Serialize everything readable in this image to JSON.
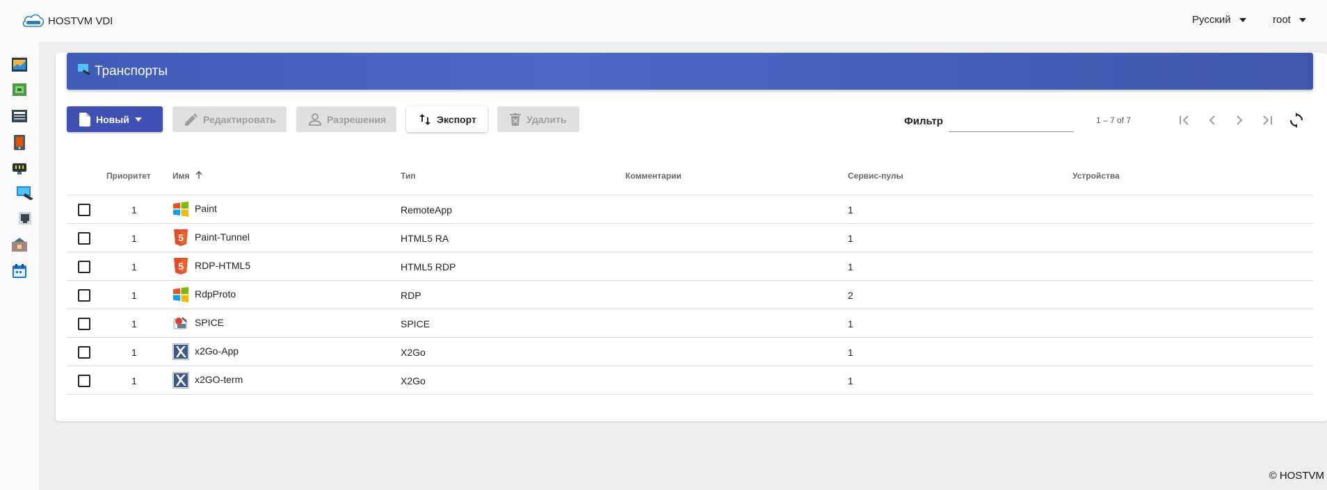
{
  "app": {
    "title": "HOSTVM VDI"
  },
  "topbar": {
    "language": "Русский",
    "user": "root"
  },
  "sidebar": {
    "items": [
      {
        "icon": "dashboard-icon"
      },
      {
        "icon": "services-chip-icon"
      },
      {
        "icon": "authenticators-icon"
      },
      {
        "icon": "os-managers-icon"
      },
      {
        "icon": "connectivity-icon"
      },
      {
        "icon": "transports-icon"
      },
      {
        "icon": "networks-icon"
      },
      {
        "icon": "pools-icon"
      },
      {
        "icon": "calendar-icon"
      }
    ]
  },
  "page": {
    "title": "Транспорты",
    "footer": "© HOSTVM"
  },
  "toolbar": {
    "new_label": "Новый",
    "edit_label": "Редактировать",
    "permissions_label": "Разрешения",
    "export_label": "Экспорт",
    "delete_label": "Удалить",
    "filter_label": "Фильтр",
    "filter_value": "",
    "range": "1 – 7 of 7"
  },
  "table": {
    "headers": {
      "priority": "Приоритет",
      "name": "Имя",
      "type": "Тип",
      "comments": "Комментарии",
      "pools": "Сервис-пулы",
      "devices": "Устройства"
    },
    "rows": [
      {
        "priority": "1",
        "name": "Paint",
        "icon": "windows-icon",
        "type": "RemoteApp",
        "comments": "",
        "pools": "1",
        "devices": ""
      },
      {
        "priority": "1",
        "name": "Paint-Tunnel",
        "icon": "html5-icon",
        "type": "HTML5 RA",
        "comments": "",
        "pools": "1",
        "devices": ""
      },
      {
        "priority": "1",
        "name": "RDP-HTML5",
        "icon": "html5-icon",
        "type": "HTML5 RDP",
        "comments": "",
        "pools": "1",
        "devices": ""
      },
      {
        "priority": "1",
        "name": "RdpProto",
        "icon": "windows-icon",
        "type": "RDP",
        "comments": "",
        "pools": "2",
        "devices": ""
      },
      {
        "priority": "1",
        "name": "SPICE",
        "icon": "spice-icon",
        "type": "SPICE",
        "comments": "",
        "pools": "1",
        "devices": ""
      },
      {
        "priority": "1",
        "name": "x2Go-App",
        "icon": "x2go-icon",
        "type": "X2Go",
        "comments": "",
        "pools": "1",
        "devices": ""
      },
      {
        "priority": "1",
        "name": "x2GO-term",
        "icon": "x2go-icon",
        "type": "X2Go",
        "comments": "",
        "pools": "1",
        "devices": ""
      }
    ]
  },
  "colors": {
    "primary": "#3f51b5",
    "header_bar": "#4563bd",
    "disabled_button": "#e0e0e0",
    "background": "#eeeeee"
  }
}
